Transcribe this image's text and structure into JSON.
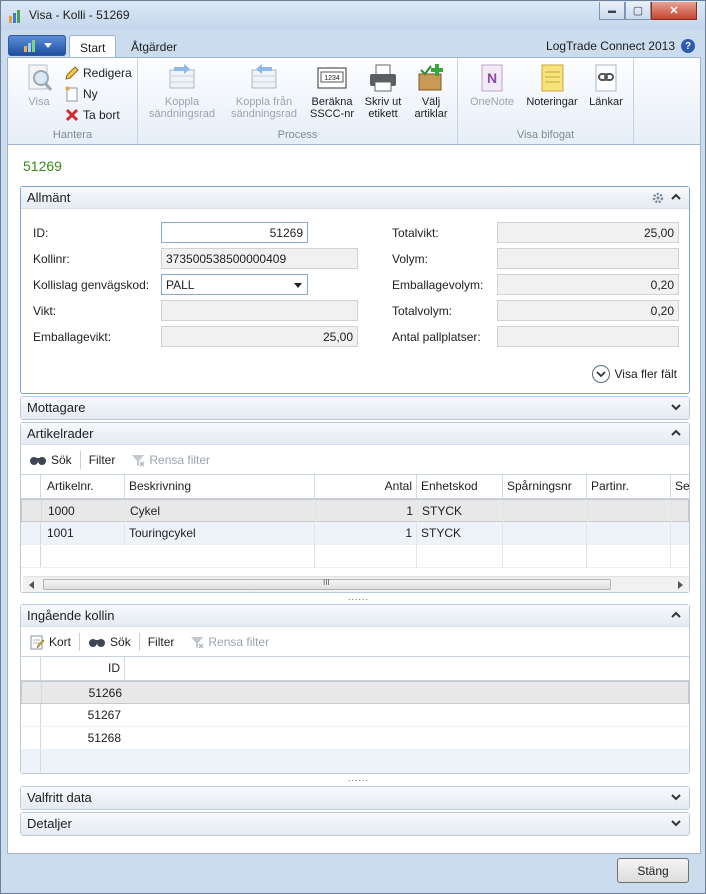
{
  "window": {
    "title": "Visa - Kolli - 51269",
    "minimize": "▬",
    "maximize": "▢",
    "close": "✕"
  },
  "ribbon": {
    "tabs": [
      "Start",
      "Åtgärder"
    ],
    "product": "LogTrade Connect 2013",
    "help": "?",
    "groups": {
      "manage": "Hantera",
      "process": "Process",
      "attached": "Visa bifogat"
    },
    "view": "Visa",
    "edit": "Redigera",
    "new": "Ny",
    "delete": "Ta bort",
    "link_shipment_l1": "Koppla",
    "link_shipment_l2": "sändningsrad",
    "unlink_l1": "Koppla från",
    "unlink_l2": "sändningsrad",
    "sscc_l1": "Beräkna",
    "sscc_l2": "SSCC-nr",
    "print_l1": "Skriv ut",
    "print_l2": "etikett",
    "choose_l1": "Välj",
    "choose_l2": "artiklar",
    "onenote": "OneNote",
    "notes": "Noteringar",
    "links": "Länkar",
    "sscc_icon_text": "1234"
  },
  "card": {
    "number": "51269"
  },
  "general": {
    "title": "Allmänt",
    "id_label": "ID:",
    "id_value": "51269",
    "kollinr_label": "Kollinr:",
    "kollinr_value": "373500538500000409",
    "kollislag_label": "Kollislag genvägskod:",
    "kollislag_value": "PALL",
    "vikt_label": "Vikt:",
    "vikt_value": "",
    "emballagevikt_label": "Emballagevikt:",
    "emballagevikt_value": "25,00",
    "totalvikt_label": "Totalvikt:",
    "totalvikt_value": "25,00",
    "volym_label": "Volym:",
    "volym_value": "",
    "emballagevolym_label": "Emballagevolym:",
    "emballagevolym_value": "0,20",
    "totalvolym_label": "Totalvolym:",
    "totalvolym_value": "0,20",
    "pallplatser_label": "Antal pallplatser:",
    "pallplatser_value": "",
    "more_fields": "Visa fler fält"
  },
  "mottagare": {
    "title": "Mottagare"
  },
  "articles": {
    "title": "Artikelrader",
    "search": "Sök",
    "filter": "Filter",
    "clear_filter": "Rensa filter",
    "columns": [
      "Artikelnr.",
      "Beskrivning",
      "Antal",
      "Enhetskod",
      "Spårningsnr",
      "Partinr.",
      "Se"
    ],
    "rows": [
      [
        "1000",
        "Cykel",
        "1",
        "STYCK"
      ],
      [
        "1001",
        "Touringcykel",
        "1",
        "STYCK"
      ]
    ],
    "scroll_thumb": "III"
  },
  "incoming": {
    "title": "Ingående kollin",
    "card": "Kort",
    "search": "Sök",
    "filter": "Filter",
    "clear_filter": "Rensa filter",
    "column": "ID",
    "rows": [
      "51266",
      "51267",
      "51268"
    ]
  },
  "splitter": "......",
  "optional": {
    "title": "Valfritt data"
  },
  "details": {
    "title": "Detaljer"
  },
  "footer": {
    "close": "Stäng"
  }
}
